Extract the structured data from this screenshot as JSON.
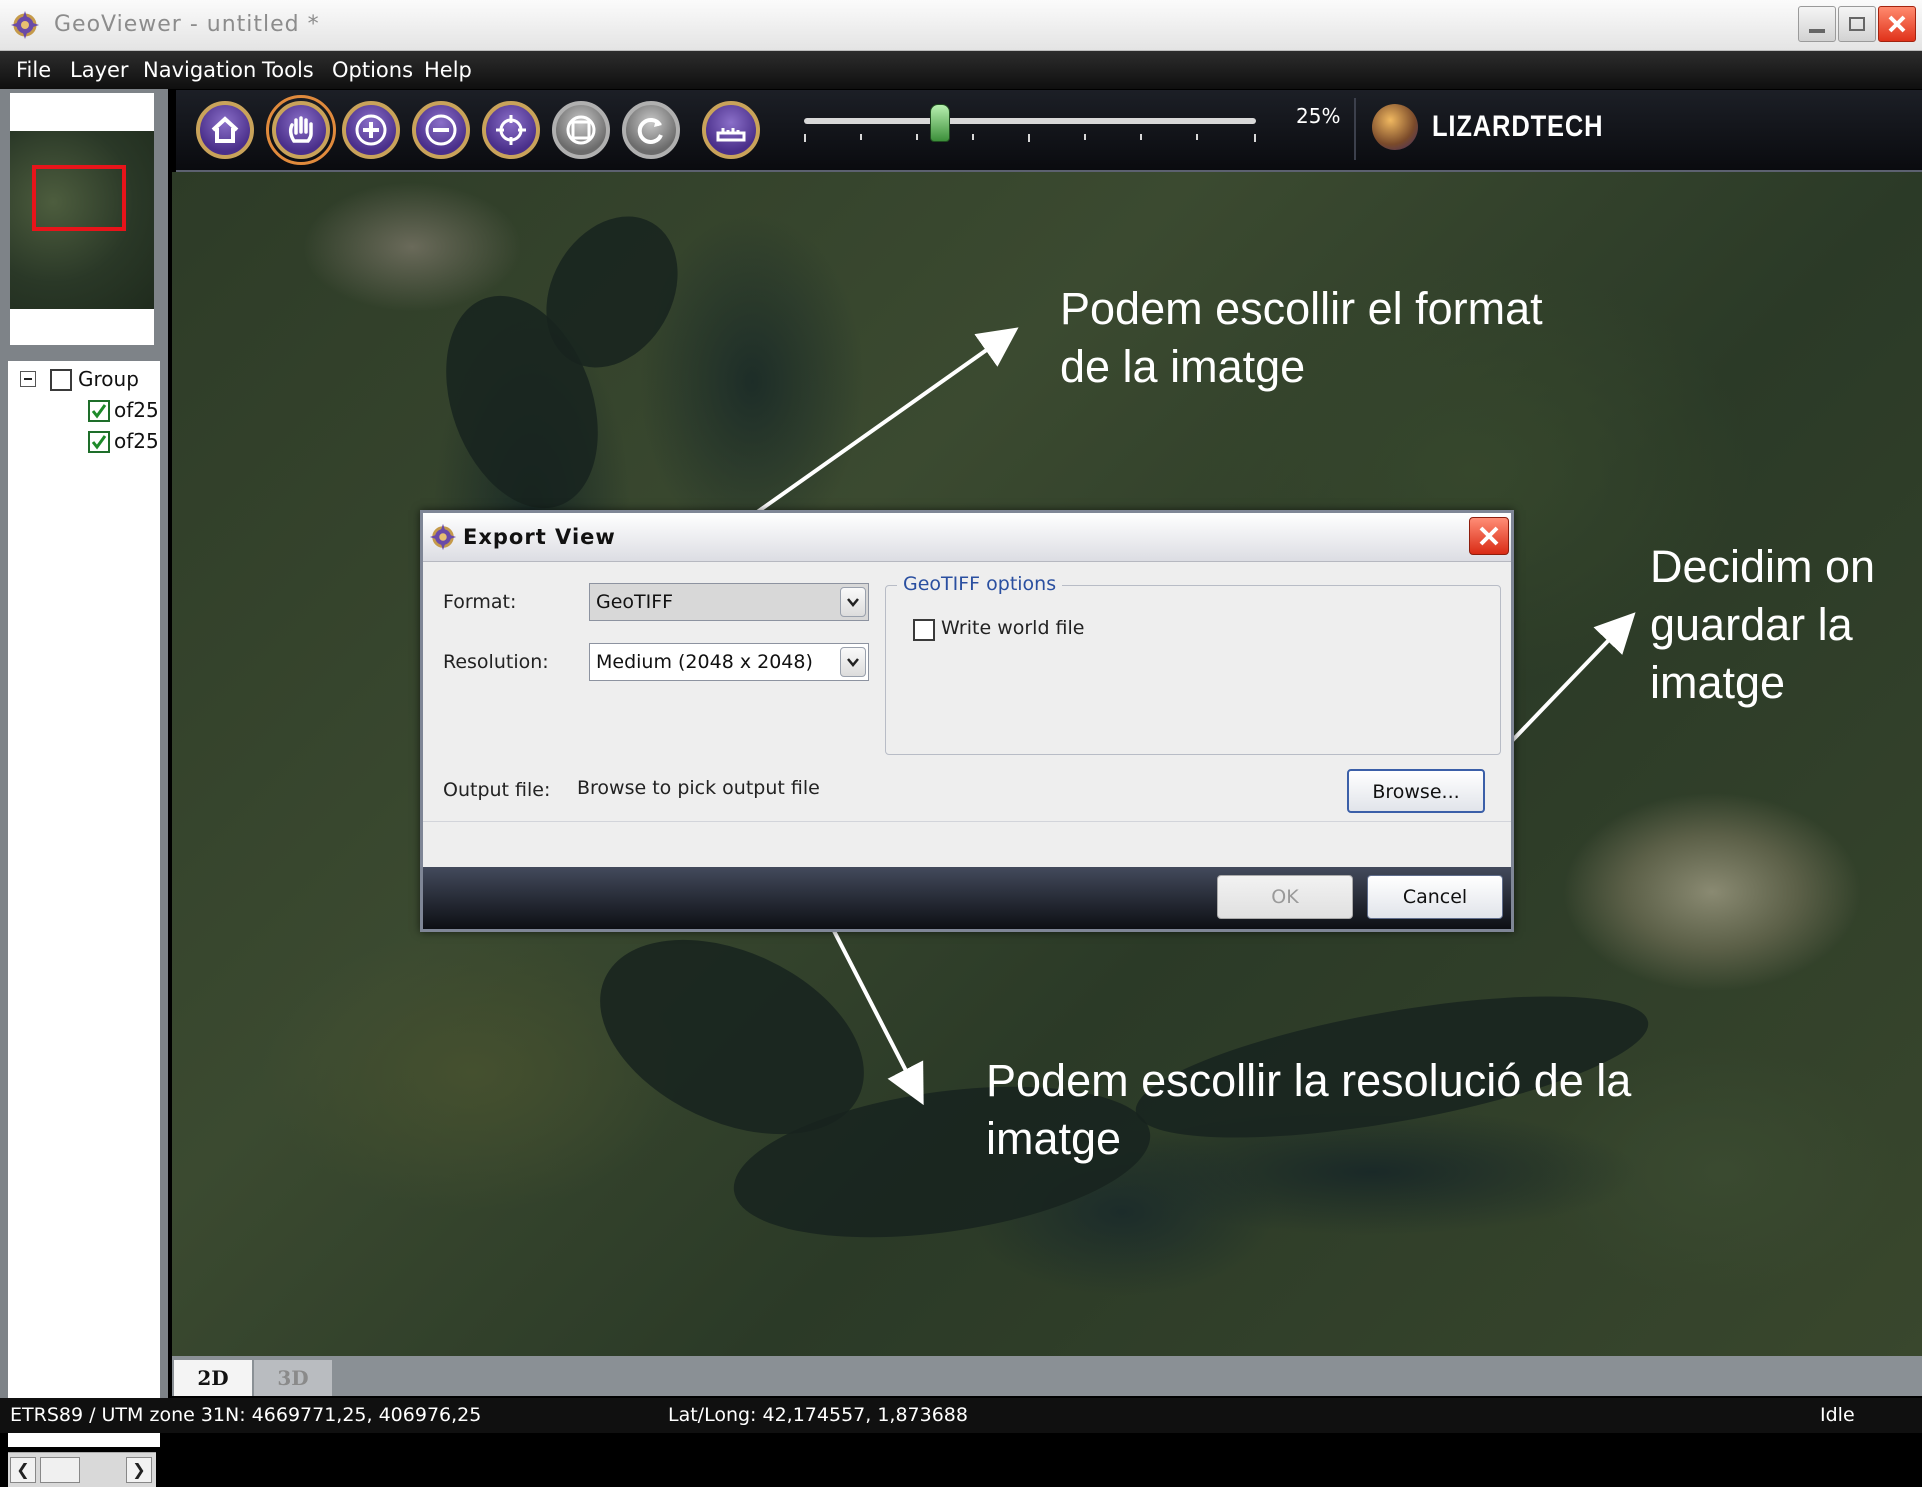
{
  "window": {
    "title": "GeoViewer - untitled *"
  },
  "menu": [
    "File",
    "Layer",
    "Navigation",
    "Tools",
    "Options",
    "Help"
  ],
  "toolbar": {
    "buttons": [
      "home",
      "pan",
      "zoom-in",
      "zoom-out",
      "center",
      "fit",
      "refresh",
      "measure"
    ],
    "zoom_label": "25%",
    "zoom_level_fraction": 0.3,
    "brand": "LIZARDTECH"
  },
  "layers": {
    "group_label": "Group",
    "items": [
      "of25",
      "of25"
    ]
  },
  "annotations": {
    "format": "Podem escollir el format de la imatge",
    "save": "Decidim on guardar la imatge",
    "resolution": "Podem escollir la resolució de la imatge"
  },
  "dialog": {
    "title": "Export View",
    "format_label": "Format:",
    "format_value": "GeoTIFF",
    "resolution_label": "Resolution:",
    "resolution_value": "Medium (2048 x 2048)",
    "options_group": "GeoTIFF options",
    "world_file_label": "Write world file",
    "output_label": "Output file:",
    "output_value": "Browse to pick output file",
    "browse": "Browse...",
    "ok": "OK",
    "cancel": "Cancel"
  },
  "tabs": [
    "2D",
    "3D"
  ],
  "status": {
    "projection": "ETRS89 / UTM zone 31N: 4669771,25, 406976,25",
    "latlong": "Lat/Long: 42,174557, 1,873688",
    "state": "Idle"
  },
  "colors": {
    "accent_purple": "#4a2f8a",
    "overview_rect": "#e8141a",
    "options_title": "#2a4fa0"
  }
}
